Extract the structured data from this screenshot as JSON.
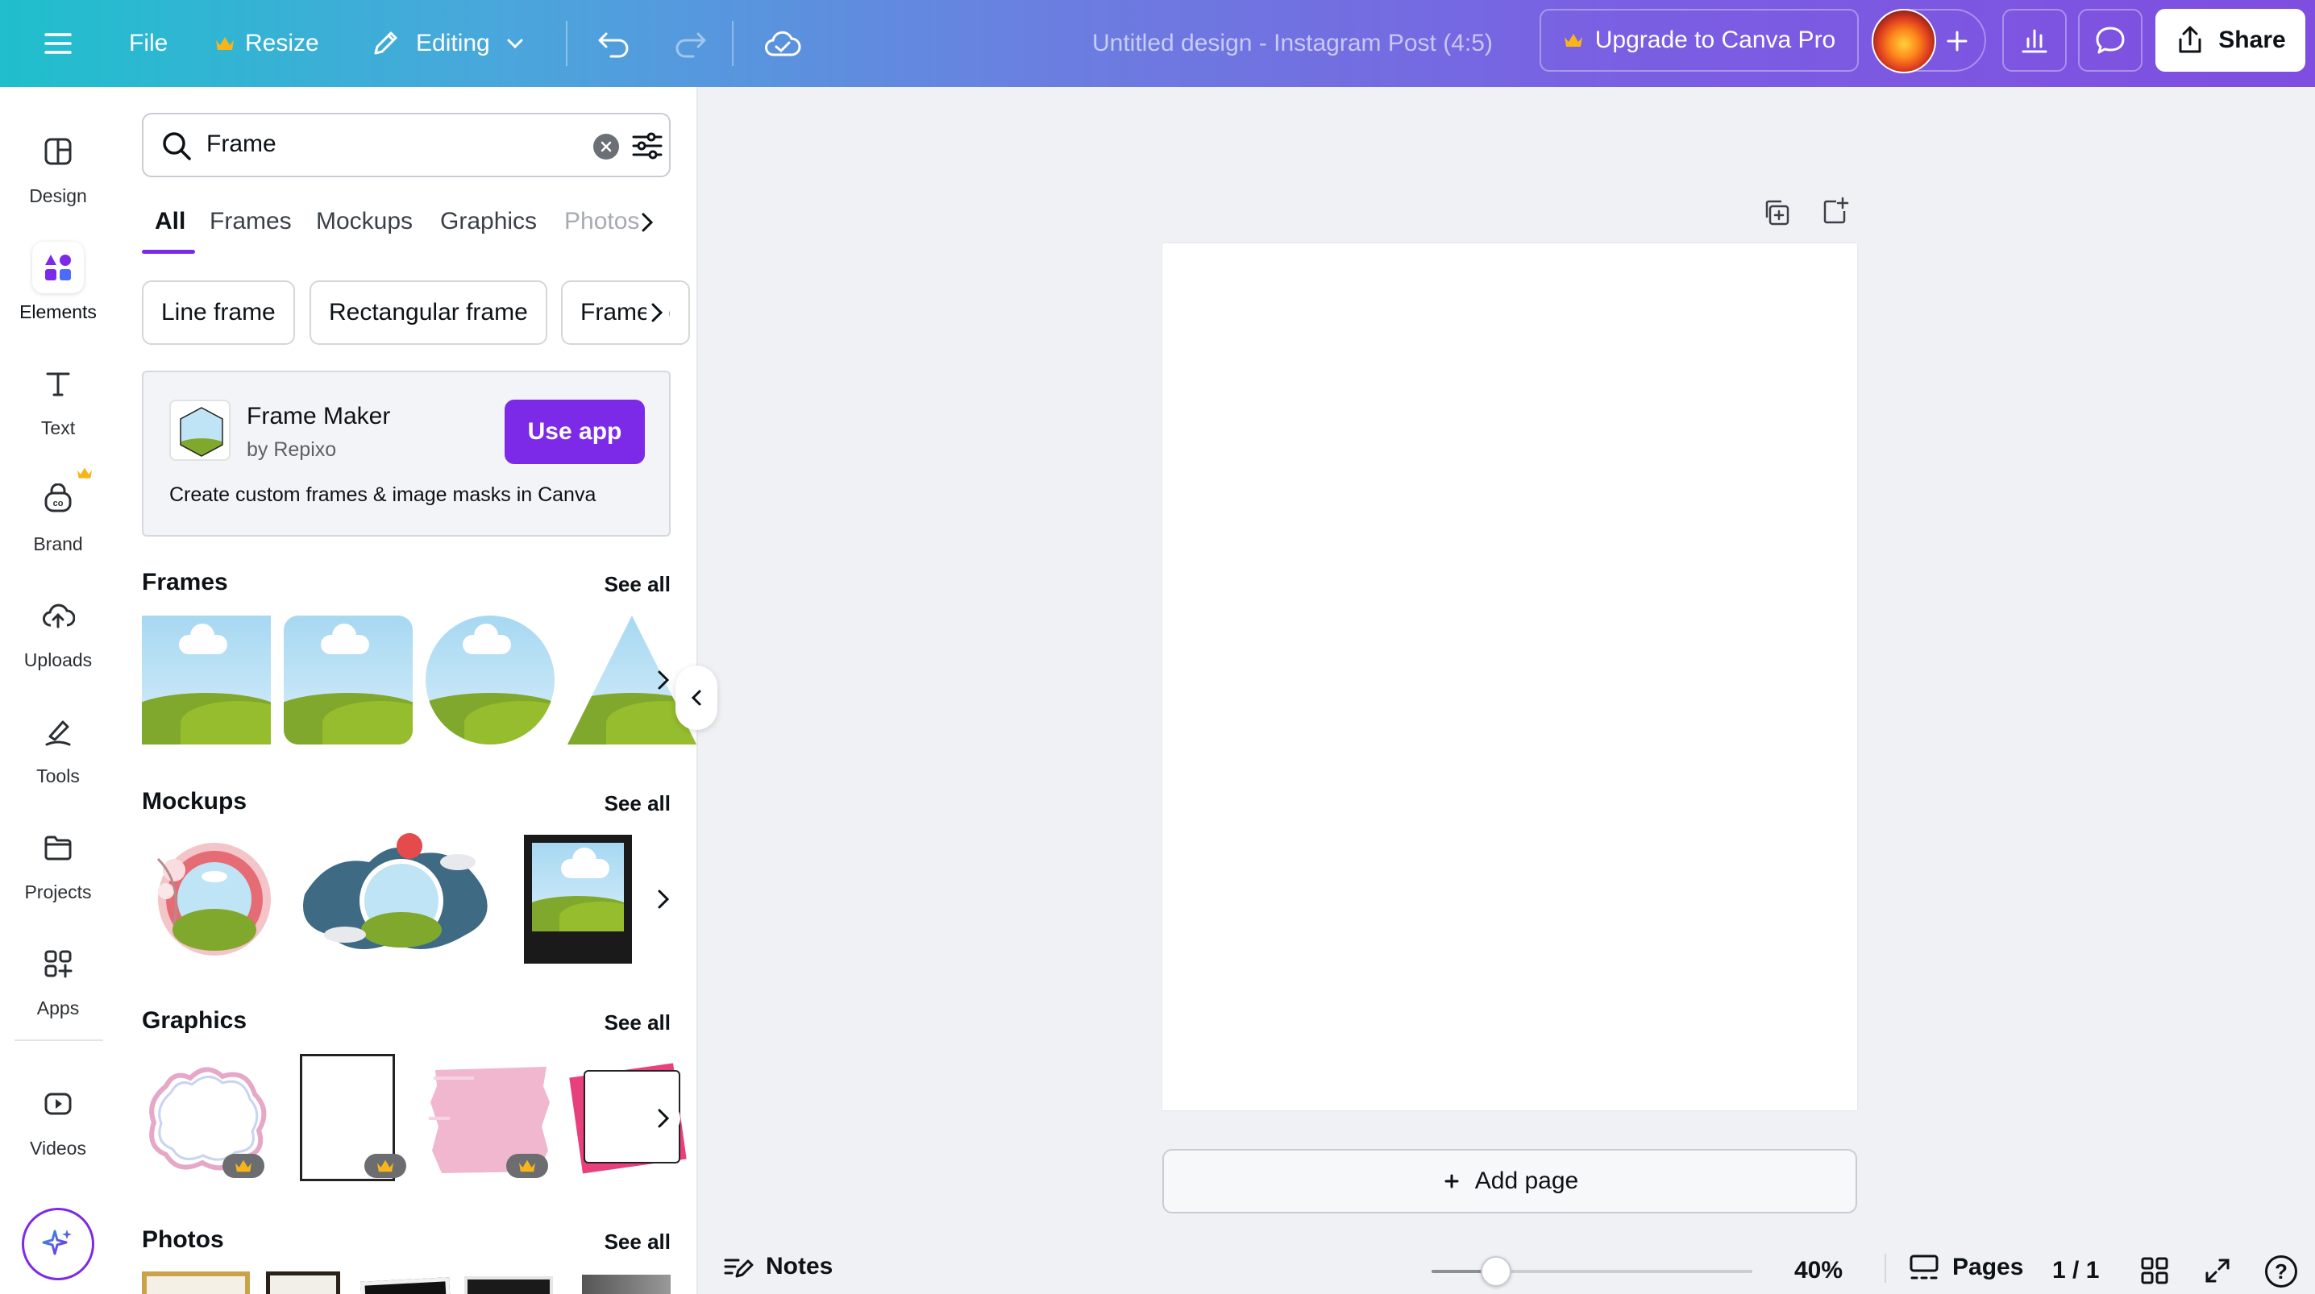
{
  "topbar": {
    "menu_icon": "hamburger-icon",
    "file": "File",
    "resize": "Resize",
    "editing": "Editing",
    "title": "Untitled design - Instagram Post (4:5)",
    "upgrade": "Upgrade to Canva Pro",
    "share": "Share"
  },
  "rail": {
    "items": [
      {
        "label": "Design",
        "icon": "design-icon"
      },
      {
        "label": "Elements",
        "icon": "elements-icon"
      },
      {
        "label": "Text",
        "icon": "text-icon"
      },
      {
        "label": "Brand",
        "icon": "brand-icon"
      },
      {
        "label": "Uploads",
        "icon": "uploads-icon"
      },
      {
        "label": "Tools",
        "icon": "tools-icon"
      },
      {
        "label": "Projects",
        "icon": "projects-icon"
      },
      {
        "label": "Apps",
        "icon": "apps-icon"
      },
      {
        "label": "Videos",
        "icon": "videos-icon"
      }
    ]
  },
  "panel": {
    "search_value": "Frame",
    "tabs": [
      "All",
      "Frames",
      "Mockups",
      "Graphics",
      "Photos"
    ],
    "chips": [
      "Line frame",
      "Rectangular frame",
      "Frame b"
    ],
    "promo": {
      "app_name": "Frame Maker",
      "author": "by Repixo",
      "button": "Use app",
      "description": "Create custom frames & image masks in Canva"
    },
    "sections": {
      "frames": "Frames",
      "mockups": "Mockups",
      "graphics": "Graphics",
      "photos": "Photos",
      "see_all": "See all"
    }
  },
  "canvas": {
    "add_page": "Add page"
  },
  "bottombar": {
    "notes": "Notes",
    "zoom": "40%",
    "zoom_level": 0.2,
    "pages": "Pages",
    "page_count": "1 / 1"
  },
  "colors": {
    "accent": "#7d2ae8",
    "crown": "#f7b519"
  }
}
